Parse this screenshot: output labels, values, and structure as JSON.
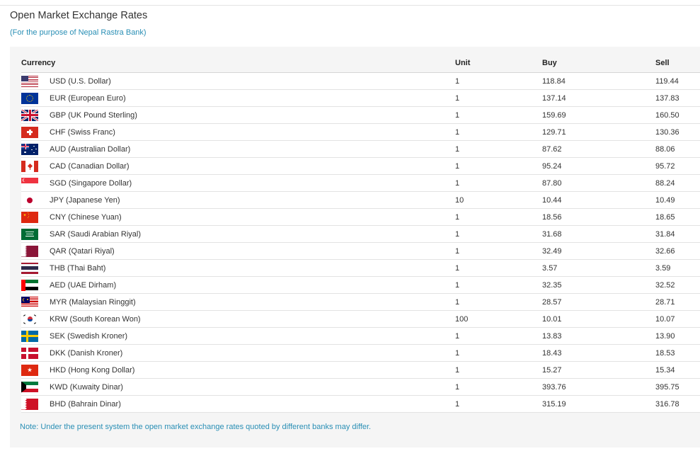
{
  "page": {
    "title": "Open Market Exchange Rates",
    "subtitle": "(For the purpose of Nepal Rastra Bank)"
  },
  "table": {
    "headers": {
      "currency": "Currency",
      "unit": "Unit",
      "buy": "Buy",
      "sell": "Sell"
    },
    "rows": [
      {
        "flag": "us-flag",
        "currency": "USD (U.S. Dollar)",
        "unit": "1",
        "buy": "118.84",
        "sell": "119.44"
      },
      {
        "flag": "eu-flag",
        "currency": "EUR (European Euro)",
        "unit": "1",
        "buy": "137.14",
        "sell": "137.83"
      },
      {
        "flag": "gb-flag",
        "currency": "GBP (UK Pound Sterling)",
        "unit": "1",
        "buy": "159.69",
        "sell": "160.50"
      },
      {
        "flag": "ch-flag",
        "currency": "CHF (Swiss Franc)",
        "unit": "1",
        "buy": "129.71",
        "sell": "130.36"
      },
      {
        "flag": "au-flag",
        "currency": "AUD (Australian Dollar)",
        "unit": "1",
        "buy": "87.62",
        "sell": "88.06"
      },
      {
        "flag": "ca-flag",
        "currency": "CAD (Canadian Dollar)",
        "unit": "1",
        "buy": "95.24",
        "sell": "95.72"
      },
      {
        "flag": "sg-flag",
        "currency": "SGD (Singapore Dollar)",
        "unit": "1",
        "buy": "87.80",
        "sell": "88.24"
      },
      {
        "flag": "jp-flag",
        "currency": "JPY (Japanese Yen)",
        "unit": "10",
        "buy": "10.44",
        "sell": "10.49"
      },
      {
        "flag": "cn-flag",
        "currency": "CNY (Chinese Yuan)",
        "unit": "1",
        "buy": "18.56",
        "sell": "18.65"
      },
      {
        "flag": "sa-flag",
        "currency": "SAR (Saudi Arabian Riyal)",
        "unit": "1",
        "buy": "31.68",
        "sell": "31.84"
      },
      {
        "flag": "qa-flag",
        "currency": "QAR (Qatari Riyal)",
        "unit": "1",
        "buy": "32.49",
        "sell": "32.66"
      },
      {
        "flag": "th-flag",
        "currency": "THB (Thai Baht)",
        "unit": "1",
        "buy": "3.57",
        "sell": "3.59"
      },
      {
        "flag": "ae-flag",
        "currency": "AED (UAE Dirham)",
        "unit": "1",
        "buy": "32.35",
        "sell": "32.52"
      },
      {
        "flag": "my-flag",
        "currency": "MYR (Malaysian Ringgit)",
        "unit": "1",
        "buy": "28.57",
        "sell": "28.71"
      },
      {
        "flag": "kr-flag",
        "currency": "KRW (South Korean Won)",
        "unit": "100",
        "buy": "10.01",
        "sell": "10.07"
      },
      {
        "flag": "se-flag",
        "currency": "SEK (Swedish Kroner)",
        "unit": "1",
        "buy": "13.83",
        "sell": "13.90"
      },
      {
        "flag": "dk-flag",
        "currency": "DKK (Danish Kroner)",
        "unit": "1",
        "buy": "18.43",
        "sell": "18.53"
      },
      {
        "flag": "hk-flag",
        "currency": "HKD (Hong Kong Dollar)",
        "unit": "1",
        "buy": "15.27",
        "sell": "15.34"
      },
      {
        "flag": "kw-flag",
        "currency": "KWD (Kuwaity Dinar)",
        "unit": "1",
        "buy": "393.76",
        "sell": "395.75"
      },
      {
        "flag": "bh-flag",
        "currency": "BHD (Bahrain Dinar)",
        "unit": "1",
        "buy": "315.19",
        "sell": "316.78"
      }
    ]
  },
  "note": "Note: Under the present system the open market exchange rates quoted by different banks may differ.",
  "colors": {
    "accent_text": "#2a8fb5",
    "panel_bg": "#f5f5f5"
  }
}
